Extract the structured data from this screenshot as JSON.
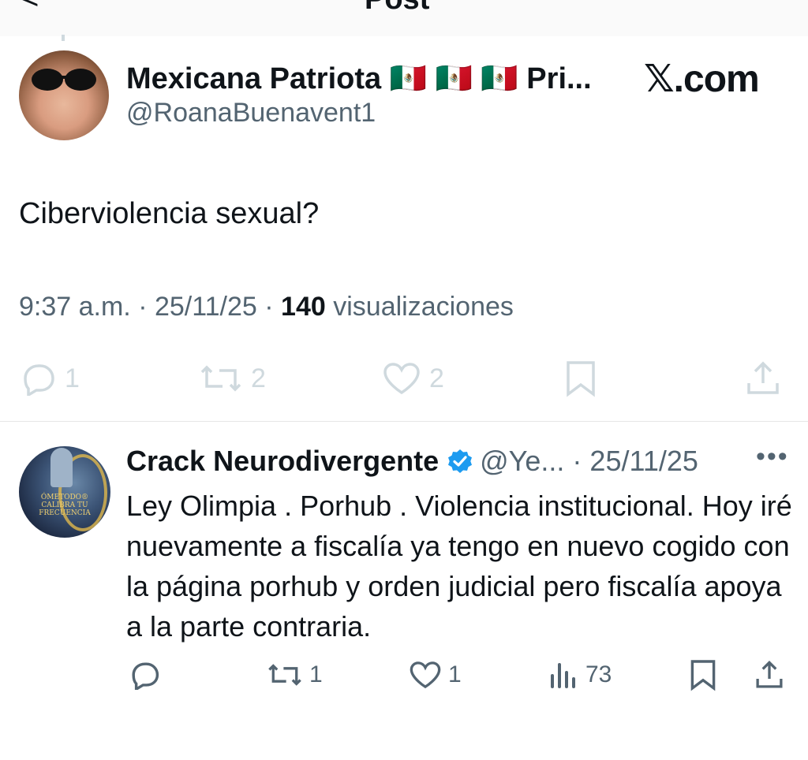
{
  "header": {
    "back_glyph": "<",
    "title": "Post"
  },
  "post": {
    "author_name": "Mexicana Patriota 🇲🇽 🇲🇽 🇲🇽 Pri...",
    "author_handle": "@RoanaBuenavent1",
    "watermark": "𝕏.com",
    "text": "Ciberviolencia sexual?",
    "time": "9:37 a.m.",
    "date": "25/11/25",
    "views_count": "140",
    "views_label": "visualizaciones",
    "actions": {
      "reply_count": "1",
      "repost_count": "2",
      "like_count": "2"
    }
  },
  "reply": {
    "author_name": "Crack Neurodivergente",
    "author_handle": "@Ye...",
    "date": "25/11/25",
    "more_glyph": "•••",
    "avatar_text": "ÓMETODO® CALIBRA TU FRECUENCIA",
    "text": "Ley Olimpia . Porhub . Violencia institucional. Hoy iré nuevamente a fiscalía ya tengo en nuevo cogido con la página porhub y orden judicial pero fiscalía apoya a la parte contraria.",
    "actions": {
      "repost_count": "1",
      "like_count": "1",
      "views_count": "73"
    }
  },
  "colors": {
    "verified": "#1d9bf0",
    "secondary_text": "#536471",
    "faded_icon": "#cfd9de"
  }
}
